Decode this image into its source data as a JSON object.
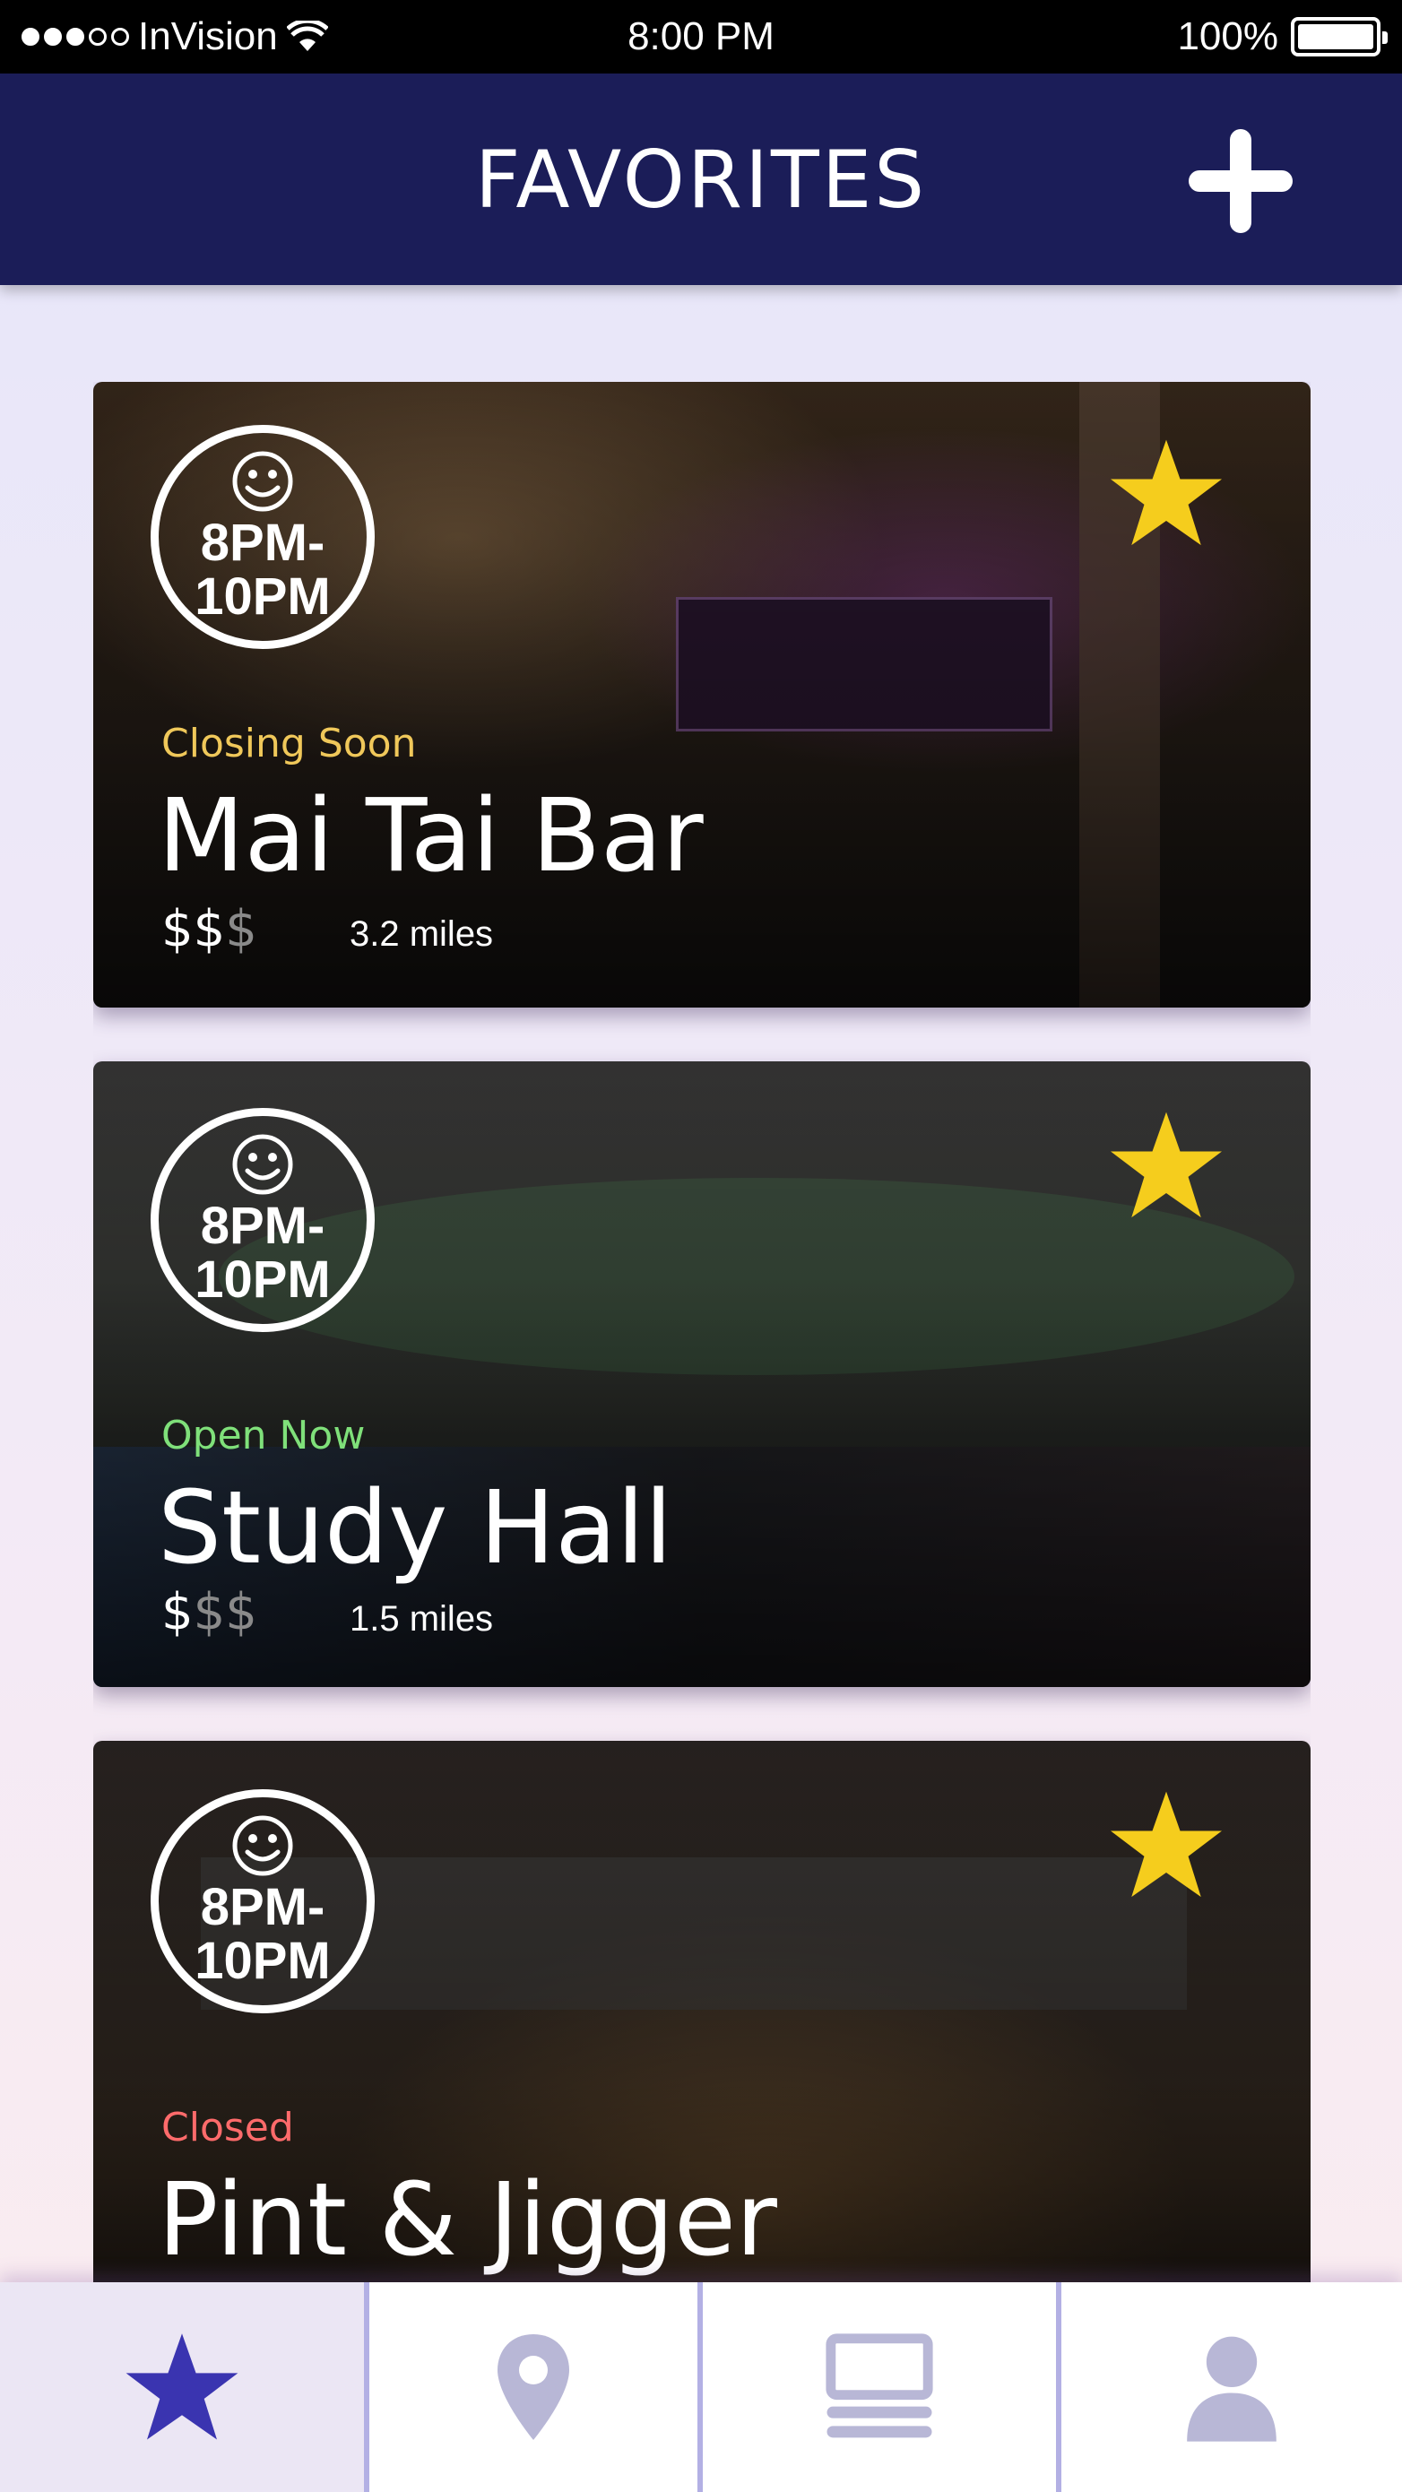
{
  "status_bar": {
    "carrier": "InVision",
    "time": "8:00 PM",
    "battery": "100%"
  },
  "header": {
    "title": "FAVORITES",
    "add_icon": "plus-icon"
  },
  "cards": [
    {
      "hours_line1": "8PM-",
      "hours_line2": "10PM",
      "status": "Closing Soon",
      "status_color": "#f0c85a",
      "name": "Mai Tai Bar",
      "price_active": "$$",
      "price_inactive": "$",
      "distance": "3.2 miles",
      "favorite_icon": "star-icon"
    },
    {
      "hours_line1": "8PM-",
      "hours_line2": "10PM",
      "status": "Open Now",
      "status_color": "#7fe07a",
      "name": "Study Hall",
      "price_active": "$",
      "price_inactive": "$$",
      "distance": "1.5 miles",
      "favorite_icon": "star-icon"
    },
    {
      "hours_line1": "8PM-",
      "hours_line2": "10PM",
      "status": "Closed",
      "status_color": "#ff6b6b",
      "name": "Pint & Jigger",
      "price_active": "",
      "price_inactive": "",
      "distance": "",
      "favorite_icon": "star-icon"
    }
  ],
  "tab_bar": {
    "tabs": [
      {
        "icon": "star-icon",
        "active": true
      },
      {
        "icon": "map-pin-icon",
        "active": false
      },
      {
        "icon": "list-icon",
        "active": false
      },
      {
        "icon": "profile-icon",
        "active": false
      }
    ]
  },
  "colors": {
    "header_bg": "#1b1d58",
    "star_yellow": "#f5cd1d",
    "active_tab_icon": "#3a34b0",
    "inactive_tab_icon": "#b8b7d6"
  }
}
